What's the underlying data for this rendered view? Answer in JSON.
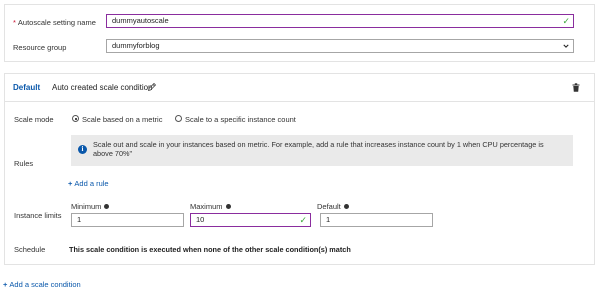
{
  "top": {
    "name_label": "Autoscale setting name",
    "required_mark": "*",
    "name_value": "dummyautoscale",
    "group_label": "Resource group",
    "group_value": "dummyforblog"
  },
  "condition": {
    "default_tag": "Default",
    "title": "Auto created scale condition",
    "scale_mode_label": "Scale mode",
    "scale_mode_options": [
      "Scale based on a metric",
      "Scale to a specific instance count"
    ],
    "scale_mode_selected": 0,
    "rules_label": "Rules",
    "info_text": "Scale out and scale in your instances based on metric. For example, add a rule that increases instance count by 1 when CPU percentage is above 70%\"",
    "add_rule": "Add a rule",
    "instance_limits_label": "Instance limits",
    "minimum_label": "Minimum",
    "minimum_value": "1",
    "maximum_label": "Maximum",
    "maximum_value": "10",
    "default_label": "Default",
    "default_value": "1",
    "schedule_label": "Schedule",
    "schedule_text": "This scale condition is executed when none of the other scale condition(s) match"
  },
  "footer": {
    "add_condition": "Add a scale condition"
  },
  "colors": {
    "accent": "#0a58ab",
    "valid_border": "#8a2d9e",
    "check": "#3aa83a",
    "required": "#c8102e"
  },
  "icons": {
    "edit": "pencil-icon",
    "delete": "trash-icon",
    "info": "info-icon",
    "valid": "checkmark-icon",
    "dropdown": "chevron-down-icon"
  }
}
